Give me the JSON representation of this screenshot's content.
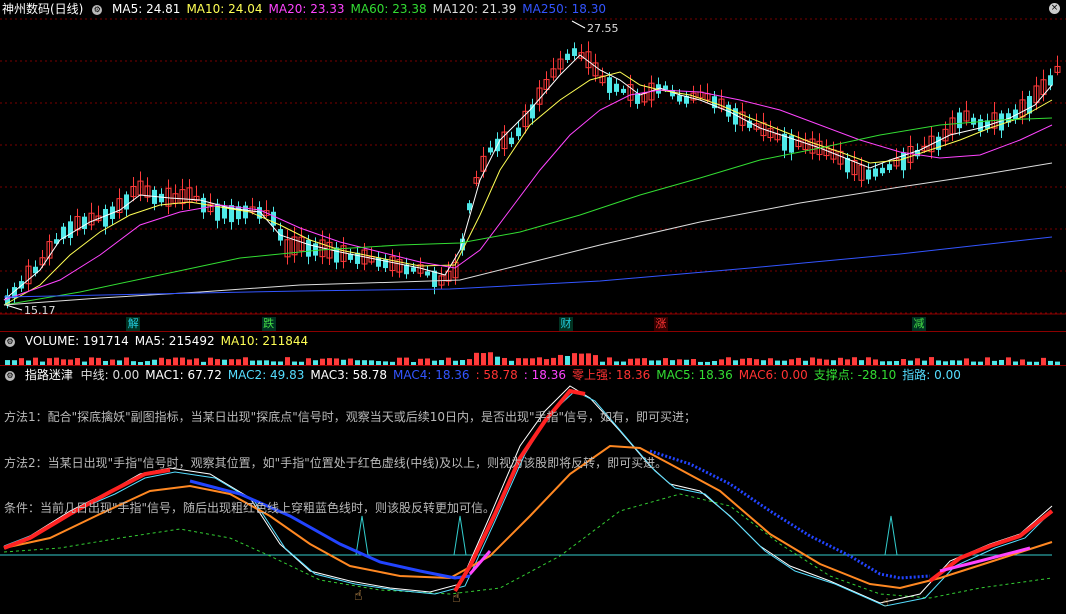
{
  "main": {
    "title": "神州数码(日线)",
    "ma": [
      {
        "label": "MA5: 24.81",
        "color": "#ffffff"
      },
      {
        "label": "MA10: 24.04",
        "color": "#ffff55"
      },
      {
        "label": "MA20: 23.33",
        "color": "#ff44ff"
      },
      {
        "label": "MA60: 23.38",
        "color": "#33dd33"
      },
      {
        "label": "MA120: 21.39",
        "color": "#dddddd"
      },
      {
        "label": "MA250: 18.30",
        "color": "#3355ff"
      }
    ],
    "high_label": "27.55",
    "low_label": "15.17",
    "signals": [
      {
        "text": "解",
        "color": "#22ccdd",
        "pos": 0.125
      },
      {
        "text": "跌",
        "color": "#44dd44",
        "pos": 0.252
      },
      {
        "text": "财",
        "color": "#22ccdd",
        "pos": 0.531
      },
      {
        "text": "涨",
        "color": "#ff3333",
        "pos": 0.62
      },
      {
        "text": "减",
        "color": "#44dd44",
        "pos": 0.862
      }
    ]
  },
  "volume": {
    "items": [
      {
        "label": "VOLUME: 191714",
        "color": "#ffffff"
      },
      {
        "label": "MA5: 215492",
        "color": "#ffffff"
      },
      {
        "label": "MA10: 211844",
        "color": "#ffff55"
      }
    ]
  },
  "indicator": {
    "name": "指路迷津",
    "items": [
      {
        "label": "中线: 0.00",
        "color": "#dddddd"
      },
      {
        "label": "MAC1: 67.72",
        "color": "#ffffff"
      },
      {
        "label": "MAC2: 49.83",
        "color": "#55ddff"
      },
      {
        "label": "MAC3: 58.78",
        "color": "#ffffff"
      },
      {
        "label": "MAC4: 18.36",
        "color": "#3355ff"
      },
      {
        "label": ": 58.78",
        "color": "#ff3333"
      },
      {
        "label": ": 18.36",
        "color": "#ff44ff"
      },
      {
        "label": "零上强: 18.36",
        "color": "#ff3333"
      },
      {
        "label": "MAC5: 18.36",
        "color": "#33dd33"
      },
      {
        "label": "MAC6: 0.00",
        "color": "#ff3333"
      },
      {
        "label": "支撑点: -28.10",
        "color": "#33dd33"
      },
      {
        "label": "指路: 0.00",
        "color": "#55ddff"
      }
    ],
    "notes": [
      "方法1：配合\"探底擒妖\"副图指标，当某日出现\"探底点\"信号时，观察当天或后续10日内，是否出现\"手指\"信号，如有，即可买进；",
      "方法2：当某日出现\"手指\"信号时，观察其位置，如\"手指\"位置处于红色虚线(中线)及以上，则视为该股即将反转，即可买进。",
      "条件：当前几日出现\"手指\"信号，随后出现粗红色线上穿粗蓝色线时，则该股反转更加可信。"
    ]
  },
  "icons": {
    "settings": "gear-icon",
    "close": "close-icon",
    "finger": "pointing-hand-icon"
  }
}
